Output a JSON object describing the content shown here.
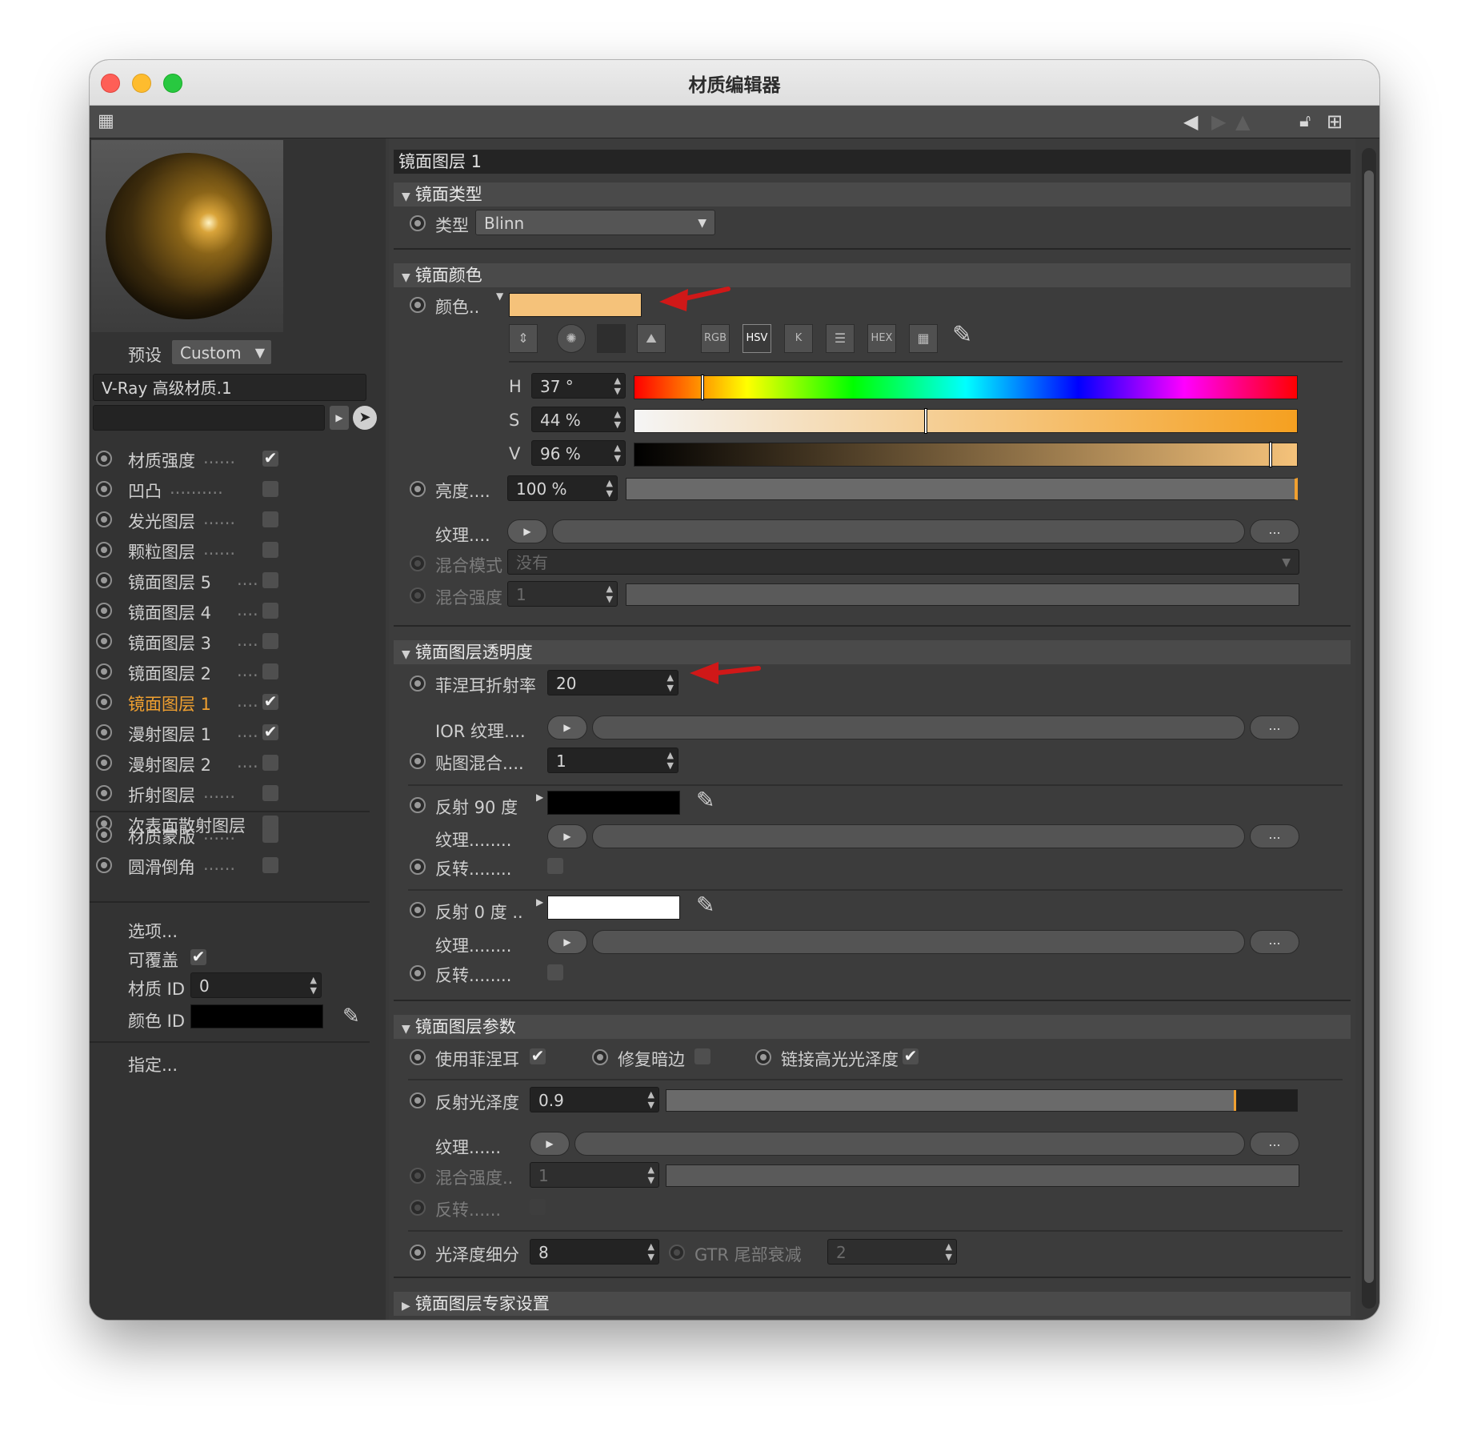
{
  "window": {
    "title": "材质编辑器"
  },
  "left": {
    "preset_label": "预设",
    "preset_value": "Custom",
    "material_name": "V-Ray 高级材质.1",
    "channels": [
      {
        "label": "材质强度",
        "dots": "......",
        "checked": "✔"
      },
      {
        "label": "凹凸",
        "dots": "..........",
        "checked": ""
      },
      {
        "label": "发光图层",
        "dots": "......",
        "checked": ""
      },
      {
        "label": "颗粒图层",
        "dots": "......",
        "checked": ""
      },
      {
        "label": "镜面图层 5",
        "dots": "....",
        "checked": ""
      },
      {
        "label": "镜面图层 4",
        "dots": "....",
        "checked": ""
      },
      {
        "label": "镜面图层 3",
        "dots": "....",
        "checked": ""
      },
      {
        "label": "镜面图层 2",
        "dots": "....",
        "checked": ""
      },
      {
        "label": "镜面图层 1",
        "dots": "....",
        "checked": "✔"
      },
      {
        "label": "漫射图层 1",
        "dots": "....",
        "checked": "✔"
      },
      {
        "label": "漫射图层 2",
        "dots": "....",
        "checked": ""
      },
      {
        "label": "折射图层",
        "dots": "......",
        "checked": ""
      },
      {
        "label": "次表面散射图层",
        "dots": "",
        "checked": ""
      }
    ],
    "extra": [
      {
        "label": "材质蒙版",
        "dots": "......",
        "checked": ""
      },
      {
        "label": "圆滑倒角",
        "dots": "......",
        "checked": ""
      }
    ],
    "options_label": "选项...",
    "overridable_label": "可覆盖",
    "overridable_check": "✔",
    "material_id_label": "材质 ID",
    "material_id_value": "0",
    "color_id_label": "颜色 ID",
    "assign_label": "指定..."
  },
  "panel": {
    "layer_title": "镜面图层 1",
    "sec_type": "镜面类型",
    "type_label": "类型",
    "type_value": "Blinn",
    "sec_color": "镜面颜色",
    "color_label": "颜色..",
    "color_hex": "#F5C27A",
    "modes": [
      "RGB",
      "HSV",
      "K",
      "HEX"
    ],
    "h_label": "H",
    "h_value": "37 °",
    "h_fraction": 0.103,
    "s_label": "S",
    "s_value": "44 %",
    "s_fraction": 0.44,
    "v_label": "V",
    "v_value": "96 %",
    "v_fraction": 0.96,
    "brightness_label": "亮度....",
    "brightness_value": "100 %",
    "texture_label": "纹理....",
    "blend_mode_label": "混合模式",
    "blend_mode_value": "没有",
    "blend_strength_label": "混合强度",
    "blend_strength_value": "1",
    "sec_transparency": "镜面图层透明度",
    "fresnel_ior_label": "菲涅耳折射率",
    "fresnel_ior_value": "20",
    "ior_tex_label": "IOR 纹理....",
    "map_blend_label": "贴图混合....",
    "map_blend_value": "1",
    "refl90_label": "反射 90 度",
    "refl90_hex": "#000000",
    "tex_label_dots": "纹理........",
    "invert_label": "反转........",
    "refl0_label": "反射 0 度 ..",
    "refl0_hex": "#FFFFFF",
    "sec_params": "镜面图层参数",
    "use_fresnel_label": "使用菲涅耳",
    "use_fresnel_check": "✔",
    "fix_dark_label": "修复暗边",
    "link_gloss_label": "链接高光光泽度",
    "link_gloss_check": "✔",
    "gloss_label": "反射光泽度",
    "gloss_value": "0.9",
    "gloss_fraction": 0.9,
    "gloss_tex_label": "纹理......",
    "gloss_blend_label": "混合强度..",
    "gloss_blend_value": "1",
    "gloss_invert_label": "反转......",
    "gloss_subdiv_label": "光泽度细分",
    "gloss_subdiv_value": "8",
    "gtr_label": "GTR 尾部衰减",
    "gtr_value": "2",
    "sec_expert": "镜面图层专家设置",
    "dots_btn": "..."
  },
  "colors": {
    "accent": "#F0A030",
    "annotation_arrow": "#D01818"
  }
}
